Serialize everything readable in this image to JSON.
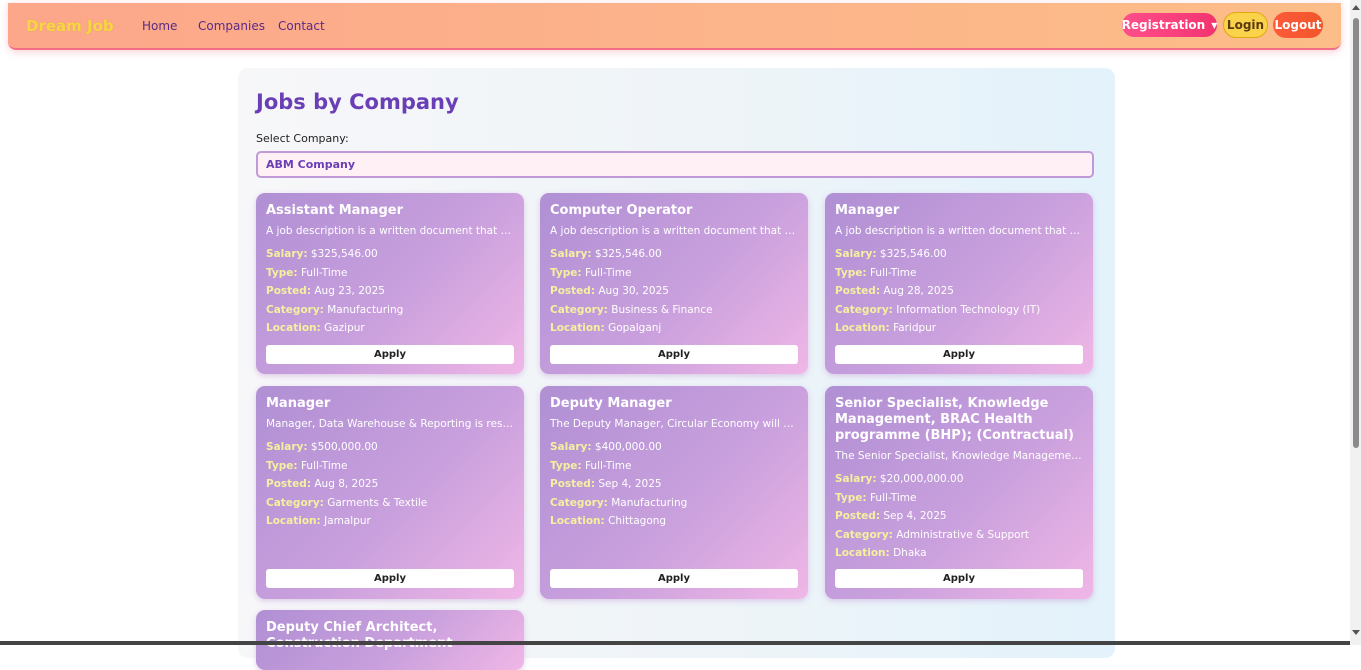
{
  "navbar": {
    "brand": "Dream Job",
    "links": [
      "Home",
      "Companies",
      "Contact"
    ],
    "registration": "Registration",
    "login": "Login",
    "logout": "Logout"
  },
  "page": {
    "title": "Jobs by Company",
    "select_label": "Select Company:",
    "selected_company": "ABM Company",
    "apply_label": "Apply",
    "labels": {
      "salary": "Salary:",
      "type": "Type:",
      "posted": "Posted:",
      "category": "Category:",
      "location": "Location:"
    }
  },
  "jobs": [
    {
      "title": "Assistant Manager",
      "description": "A job description is a written document that details the duties",
      "salary": "$325,546.00",
      "type": "Full-Time",
      "posted": "Aug 23, 2025",
      "category": "Manufacturing",
      "location": "Gazipur"
    },
    {
      "title": "Computer Operator",
      "description": "A job description is a written document that details the duties",
      "salary": "$325,546.00",
      "type": "Full-Time",
      "posted": "Aug 30, 2025",
      "category": "Business & Finance",
      "location": "Gopalganj"
    },
    {
      "title": "Manager",
      "description": "A job description is a written document that details the duties",
      "salary": "$325,546.00",
      "type": "Full-Time",
      "posted": "Aug 28, 2025",
      "category": "Information Technology (IT)",
      "location": "Faridpur"
    },
    {
      "title": "Manager",
      "description": "Manager, Data Warehouse & Reporting is responsible for",
      "salary": "$500,000.00",
      "type": "Full-Time",
      "posted": "Aug 8, 2025",
      "category": "Garments & Textile",
      "location": "Jamalpur"
    },
    {
      "title": "Deputy Manager",
      "description": "The Deputy Manager, Circular Economy will be responsible for",
      "salary": "$400,000.00",
      "type": "Full-Time",
      "posted": "Sep 4, 2025",
      "category": "Manufacturing",
      "location": "Chittagong"
    },
    {
      "title": "Senior Specialist, Knowledge Management, BRAC Health programme (BHP); (Contractual)",
      "description": "The Senior Specialist, Knowledge Management will be responsible",
      "salary": "$20,000,000.00",
      "type": "Full-Time",
      "posted": "Sep 4, 2025",
      "category": "Administrative & Support",
      "location": "Dhaka"
    },
    {
      "title": "Deputy Chief Architect, Construction Department"
    }
  ]
}
